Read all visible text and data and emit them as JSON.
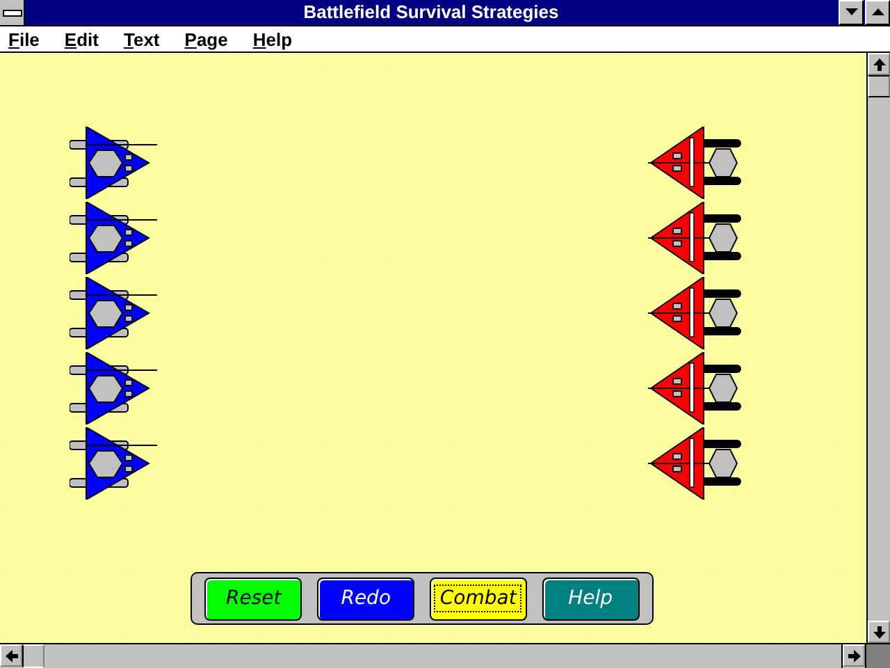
{
  "window": {
    "title": "Battlefield Survival Strategies"
  },
  "menu": [
    "File",
    "Edit",
    "Text",
    "Page",
    "Help"
  ],
  "left_units": [
    {
      "color": "#0000ff"
    },
    {
      "color": "#0000ff"
    },
    {
      "color": "#0000ff"
    },
    {
      "color": "#0000ff"
    },
    {
      "color": "#0000ff"
    }
  ],
  "right_units": [
    {
      "color": "#ff0000"
    },
    {
      "color": "#ff0000"
    },
    {
      "color": "#ff0000"
    },
    {
      "color": "#ff0000"
    },
    {
      "color": "#ff0000"
    }
  ],
  "buttons": [
    {
      "label": "Reset",
      "color": "#00ff00",
      "focused": false
    },
    {
      "label": "Redo",
      "color": "#0000ff",
      "focused": false
    },
    {
      "label": "Combat",
      "color": "#ffff00",
      "focused": true
    },
    {
      "label": "Help",
      "color": "#008080",
      "focused": false
    }
  ]
}
